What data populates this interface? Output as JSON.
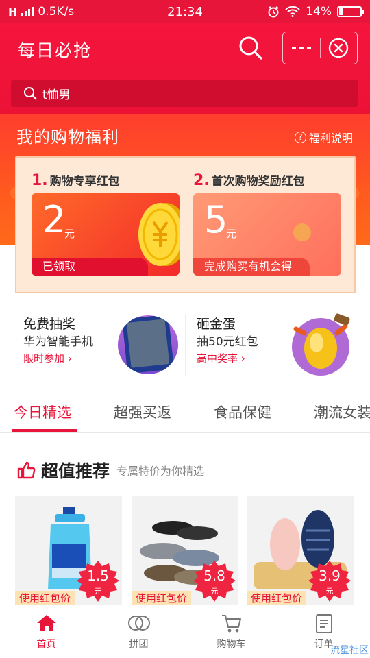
{
  "status_bar": {
    "network_speed": "0.5K/s",
    "time": "21:34",
    "battery": "14%"
  },
  "header": {
    "title": "每日必抢",
    "search_query": "t恤男"
  },
  "welfare": {
    "title": "我的购物福利",
    "help_label": "福利说明",
    "cards": [
      {
        "num": "1.",
        "title": "购物专享红包",
        "amount": "2",
        "unit": "元",
        "footer": "已领取"
      },
      {
        "num": "2.",
        "title": "首次购物奖励红包",
        "amount": "5",
        "unit": "元",
        "footer": "完成购买有机会得"
      }
    ]
  },
  "promos": [
    {
      "title": "免费抽奖",
      "subtitle": "华为智能手机",
      "link": "限时参加 ›"
    },
    {
      "title": "砸金蛋",
      "subtitle": "抽50元红包",
      "link": "高中奖率 ›"
    }
  ],
  "tabs": [
    "今日精选",
    "超强买返",
    "食品保健",
    "潮流女装"
  ],
  "recommend": {
    "title": "超值推荐",
    "subtitle": "专属特价为你精选",
    "products": [
      {
        "tag": "使用红包价",
        "price": "1.5",
        "unit": "元"
      },
      {
        "tag": "使用红包价",
        "price": "5.8",
        "unit": "元"
      },
      {
        "tag": "使用红包价",
        "price": "3.9",
        "unit": "元"
      }
    ]
  },
  "tabbar": [
    {
      "label": "首页",
      "icon": "home-icon"
    },
    {
      "label": "拼团",
      "icon": "group-icon"
    },
    {
      "label": "购物车",
      "icon": "cart-icon"
    },
    {
      "label": "订单",
      "icon": "order-icon"
    }
  ],
  "watermark": "流星社区",
  "colors": {
    "brand": "#e8153a",
    "coupon_orange": "#ff6a2a",
    "badge_red": "#ef2440"
  }
}
